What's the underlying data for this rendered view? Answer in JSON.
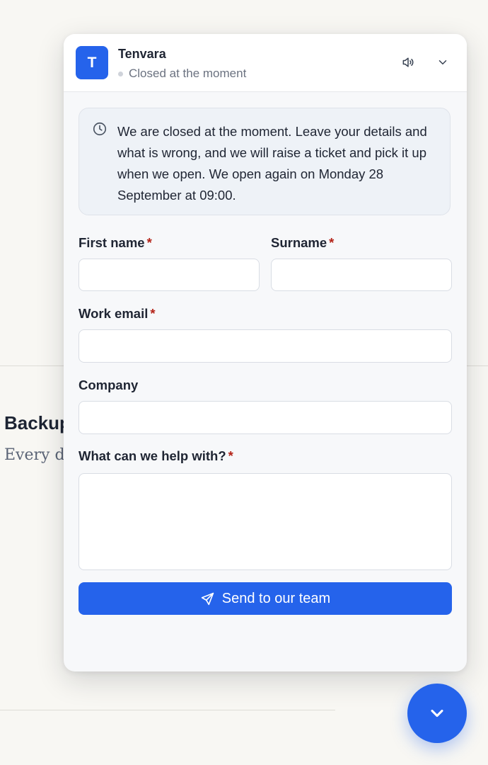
{
  "background": {
    "heading": "Backup",
    "paragraph": "Every d offsite, they wo"
  },
  "widget": {
    "avatar_letter": "T",
    "brand_name": "Tenvara",
    "status_text": "Closed at the moment",
    "notice": "We are closed at the moment. Leave your details and what is wrong, and we will raise a ticket and pick it up when we open. We open again on Monday 28 September at 09:00.",
    "form": {
      "first_name_label": "First name",
      "surname_label": "Surname",
      "email_label": "Work email",
      "company_label": "Company",
      "help_label": "What can we help with?",
      "required_marker": "*",
      "first_name_value": "",
      "surname_value": "",
      "email_value": "",
      "company_value": "",
      "help_value": ""
    },
    "send_label": "Send to our team"
  },
  "icons": {
    "clock": "clock-icon",
    "sound": "speaker-icon",
    "collapse": "chevron-down-icon",
    "send": "paper-plane-icon",
    "fab": "chevron-down-icon"
  },
  "colors": {
    "accent": "#2563eb",
    "required": "#b42318",
    "panel_bg": "#f7f8fa",
    "notice_bg": "#eef2f7"
  }
}
